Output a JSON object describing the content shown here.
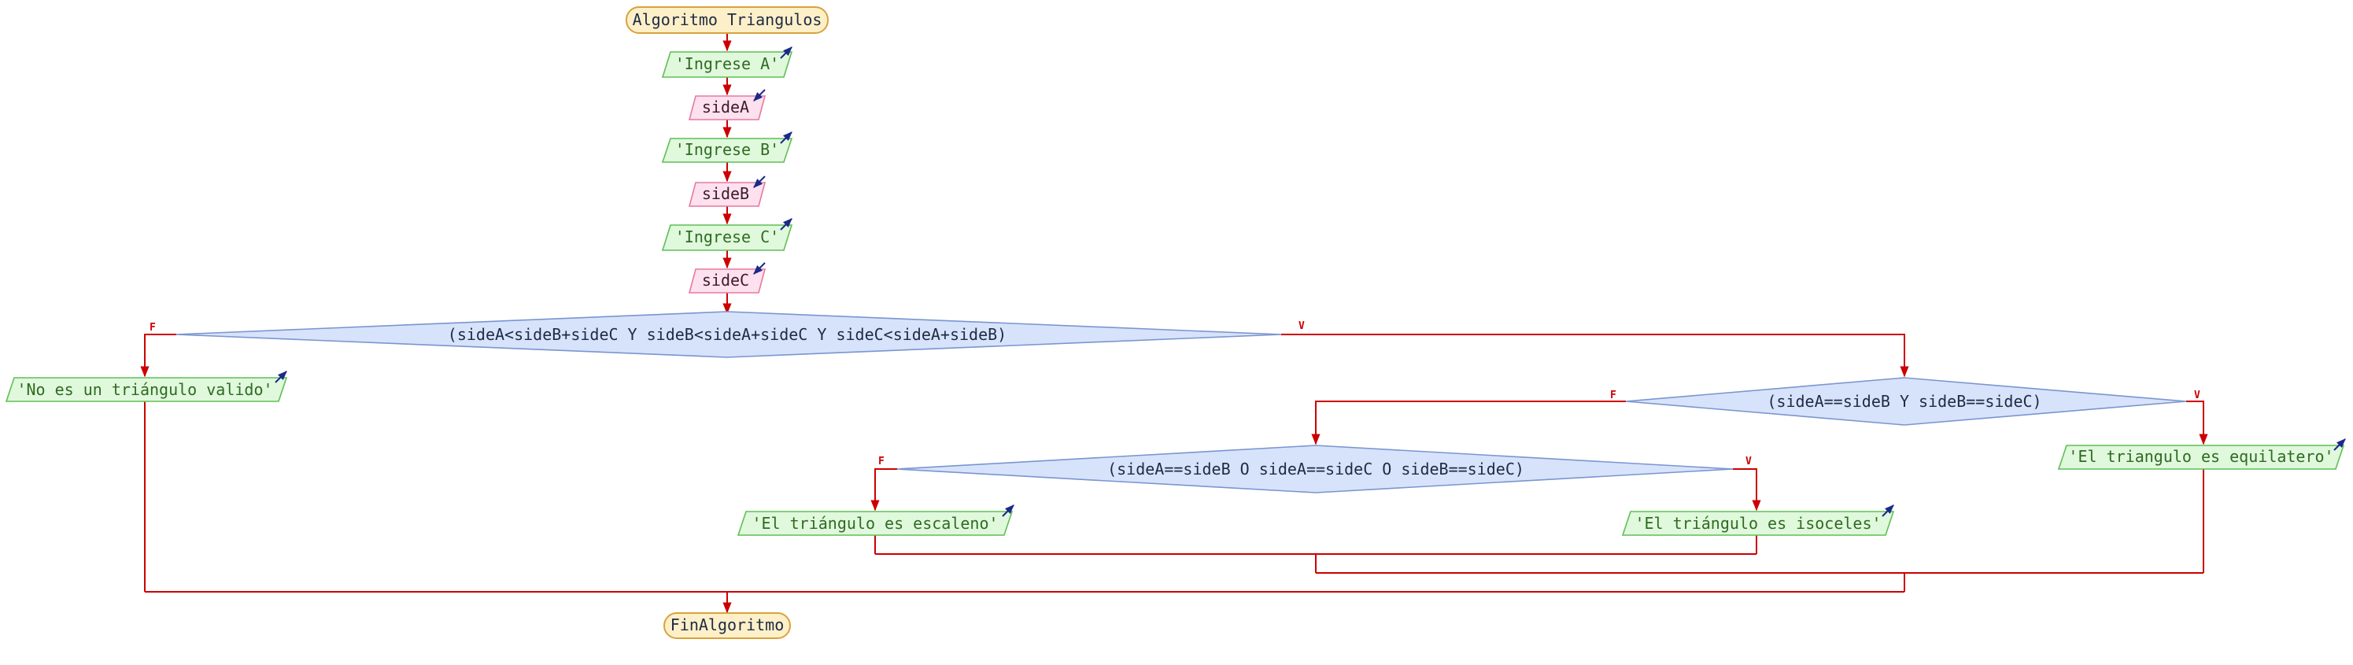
{
  "flowchart": {
    "start": "Algoritmo Triangulos",
    "end": "FinAlgoritmo",
    "prompt_a": "'Ingrese A'",
    "read_a": "sideA",
    "prompt_b": "'Ingrese B'",
    "read_b": "sideB",
    "prompt_c": "'Ingrese C'",
    "read_c": "sideC",
    "decision_valid": "(sideA<sideB+sideC Y sideB<sideA+sideC Y sideC<sideA+sideB)",
    "decision_equilateral": "(sideA==sideB Y sideB==sideC)",
    "decision_isosceles": "(sideA==sideB O sideA==sideC O sideB==sideC)",
    "out_invalid": "'No es un triángulo valido'",
    "out_equilateral": "'El triangulo es equilatero'",
    "out_scalene": "'El triángulo es escaleno'",
    "out_isosceles": "'El triángulo es isoceles'",
    "false_label": "F",
    "true_label": "V"
  },
  "colors": {
    "flow_line": "#cc0000",
    "terminal_fill": "#fdf0c8",
    "output_fill": "#e0f8dc",
    "input_fill": "#fde1ee",
    "decision_fill": "#d7e3fb",
    "io_arrow": "#1a2a8a"
  },
  "icons": {
    "output_marker": "arrow-up-right-icon",
    "input_marker": "arrow-down-left-icon"
  }
}
